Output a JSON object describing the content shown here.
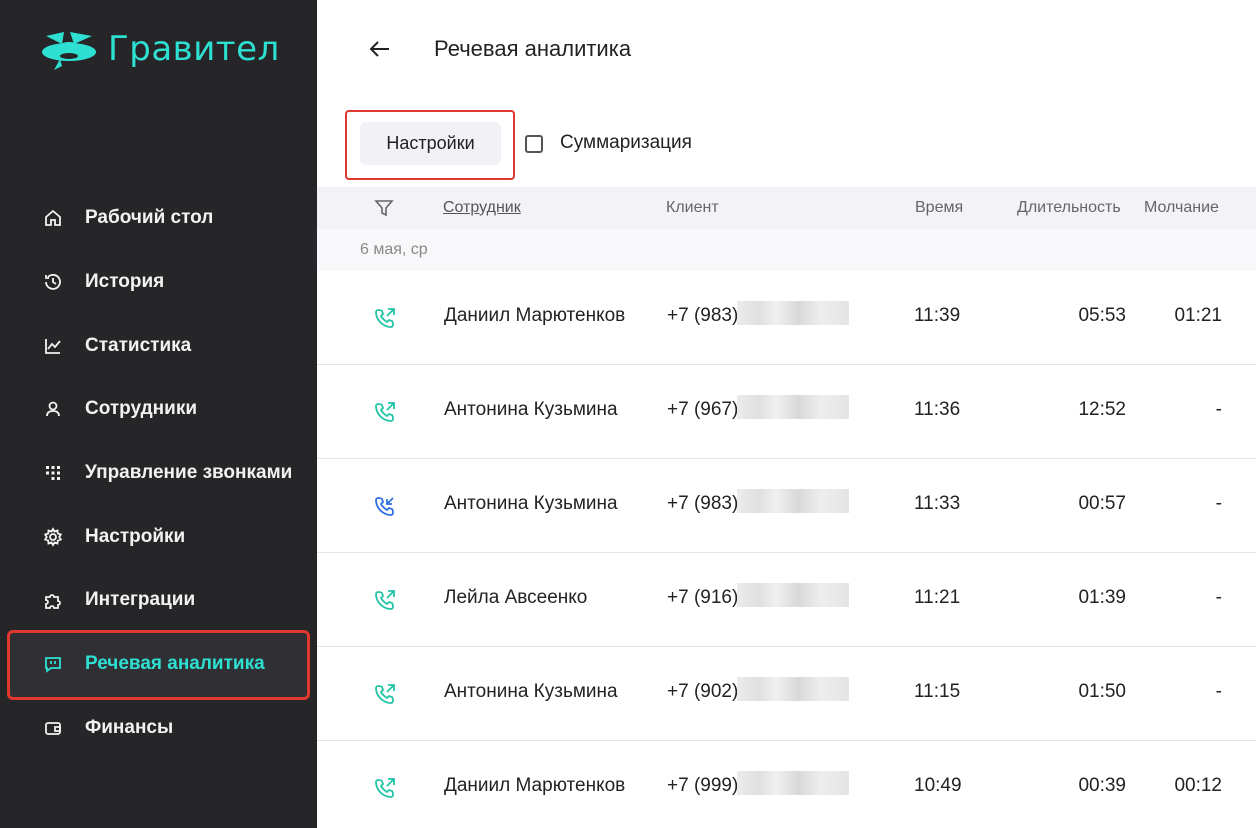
{
  "app": {
    "name": "Гравител",
    "brand_color": "#2ee0d2",
    "highlight_color": "#e0382f"
  },
  "sidebar": {
    "items": [
      {
        "label": "Рабочий стол",
        "icon": "home-icon"
      },
      {
        "label": "История",
        "icon": "history-icon"
      },
      {
        "label": "Статистика",
        "icon": "chart-line-icon"
      },
      {
        "label": "Сотрудники",
        "icon": "user-icon"
      },
      {
        "label": "Управление звонками",
        "icon": "dialpad-icon"
      },
      {
        "label": "Настройки",
        "icon": "gear-icon"
      },
      {
        "label": "Интеграции",
        "icon": "puzzle-icon"
      },
      {
        "label": "Речевая аналитика",
        "icon": "speech-bubble-icon",
        "active": true
      },
      {
        "label": "Финансы",
        "icon": "wallet-icon"
      }
    ]
  },
  "header": {
    "title": "Речевая аналитика"
  },
  "toolbar": {
    "settings_label": "Настройки",
    "summarize_label": "Суммаризация",
    "summarize_checked": false
  },
  "table": {
    "columns": {
      "employee": "Сотрудник",
      "client": "Клиент",
      "time": "Время",
      "duration": "Длительность",
      "silence": "Молчание"
    },
    "date_group": "6 мая, ср",
    "rows": [
      {
        "direction": "outgoing",
        "employee": "Даниил Марютенков",
        "client": "+7 (983)",
        "time": "11:39",
        "duration": "05:53",
        "silence": "01:21"
      },
      {
        "direction": "outgoing",
        "employee": "Антонина Кузьмина",
        "client": "+7 (967)",
        "time": "11:36",
        "duration": "12:52",
        "silence": "-"
      },
      {
        "direction": "incoming",
        "employee": "Антонина Кузьмина",
        "client": "+7 (983)",
        "time": "11:33",
        "duration": "00:57",
        "silence": "-"
      },
      {
        "direction": "outgoing",
        "employee": "Лейла Авсеенко",
        "client": "+7 (916)",
        "time": "11:21",
        "duration": "01:39",
        "silence": "-"
      },
      {
        "direction": "outgoing",
        "employee": "Антонина Кузьмина",
        "client": "+7 (902)",
        "time": "11:15",
        "duration": "01:50",
        "silence": "-"
      },
      {
        "direction": "outgoing",
        "employee": "Даниил Марютенков",
        "client": "+7 (999)",
        "time": "10:49",
        "duration": "00:39",
        "silence": "00:12"
      }
    ]
  }
}
